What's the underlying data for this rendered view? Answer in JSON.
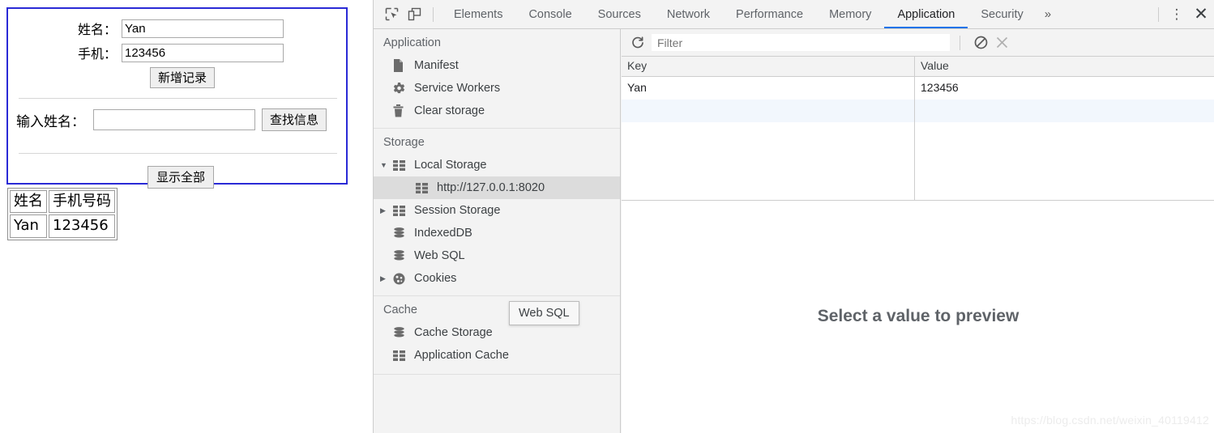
{
  "page": {
    "form": {
      "name_label": "姓名：",
      "name_value": "Yan",
      "phone_label": "手机：",
      "phone_value": "123456",
      "add_button": "新增记录",
      "query_label": "输入姓名：",
      "query_value": "",
      "find_button": "查找信息",
      "show_all_button": "显示全部"
    },
    "result_table": {
      "headers": [
        "姓名",
        "手机号码"
      ],
      "rows": [
        [
          "Yan",
          "123456"
        ]
      ]
    }
  },
  "devtools": {
    "toolbar": {
      "inspect_icon": "inspect-element-icon",
      "device_icon": "device-toolbar-icon",
      "more_tabs": "»",
      "menu_icon": "⋮",
      "close_icon": "✕"
    },
    "tabs": [
      {
        "label": "Elements",
        "active": false
      },
      {
        "label": "Console",
        "active": false
      },
      {
        "label": "Sources",
        "active": false
      },
      {
        "label": "Network",
        "active": false
      },
      {
        "label": "Performance",
        "active": false
      },
      {
        "label": "Memory",
        "active": false
      },
      {
        "label": "Application",
        "active": true
      },
      {
        "label": "Security",
        "active": false
      }
    ],
    "sidebar": {
      "sections": [
        {
          "title": "Application",
          "items": [
            {
              "label": "Manifest",
              "icon": "document-icon",
              "arrow": "none",
              "indent": 1,
              "selected": false
            },
            {
              "label": "Service Workers",
              "icon": "gear-icon",
              "arrow": "none",
              "indent": 1,
              "selected": false
            },
            {
              "label": "Clear storage",
              "icon": "trash-icon",
              "arrow": "none",
              "indent": 1,
              "selected": false
            }
          ]
        },
        {
          "title": "Storage",
          "items": [
            {
              "label": "Local Storage",
              "icon": "grid-icon",
              "arrow": "down",
              "indent": 1,
              "selected": false
            },
            {
              "label": "http://127.0.0.1:8020",
              "icon": "grid-icon",
              "arrow": "none",
              "indent": 2,
              "selected": true
            },
            {
              "label": "Session Storage",
              "icon": "grid-icon",
              "arrow": "right",
              "indent": 1,
              "selected": false
            },
            {
              "label": "IndexedDB",
              "icon": "database-icon",
              "arrow": "none",
              "indent": 1,
              "selected": false
            },
            {
              "label": "Web SQL",
              "icon": "database-icon",
              "arrow": "none",
              "indent": 1,
              "selected": false
            },
            {
              "label": "Cookies",
              "icon": "cookie-icon",
              "arrow": "right",
              "indent": 1,
              "selected": false
            }
          ]
        },
        {
          "title": "Cache",
          "items": [
            {
              "label": "Cache Storage",
              "icon": "database-icon",
              "arrow": "none",
              "indent": 1,
              "selected": false
            },
            {
              "label": "Application Cache",
              "icon": "grid-icon",
              "arrow": "none",
              "indent": 1,
              "selected": false
            }
          ]
        }
      ],
      "tooltip": "Web SQL"
    },
    "filter_bar": {
      "refresh_icon": "refresh-icon",
      "placeholder": "Filter",
      "value": "",
      "clear_all_icon": "no-entry-icon",
      "delete_icon": "close-icon"
    },
    "storage_table": {
      "columns": [
        "Key",
        "Value"
      ],
      "rows": [
        {
          "key": "Yan",
          "value": "123456"
        },
        {
          "key": "",
          "value": ""
        }
      ]
    },
    "preview_placeholder": "Select a value to preview",
    "watermark": "https://blog.csdn.net/weixin_40119412",
    "accent_color": "#1a73e8",
    "selected_row_color": "#f2f7fd"
  }
}
